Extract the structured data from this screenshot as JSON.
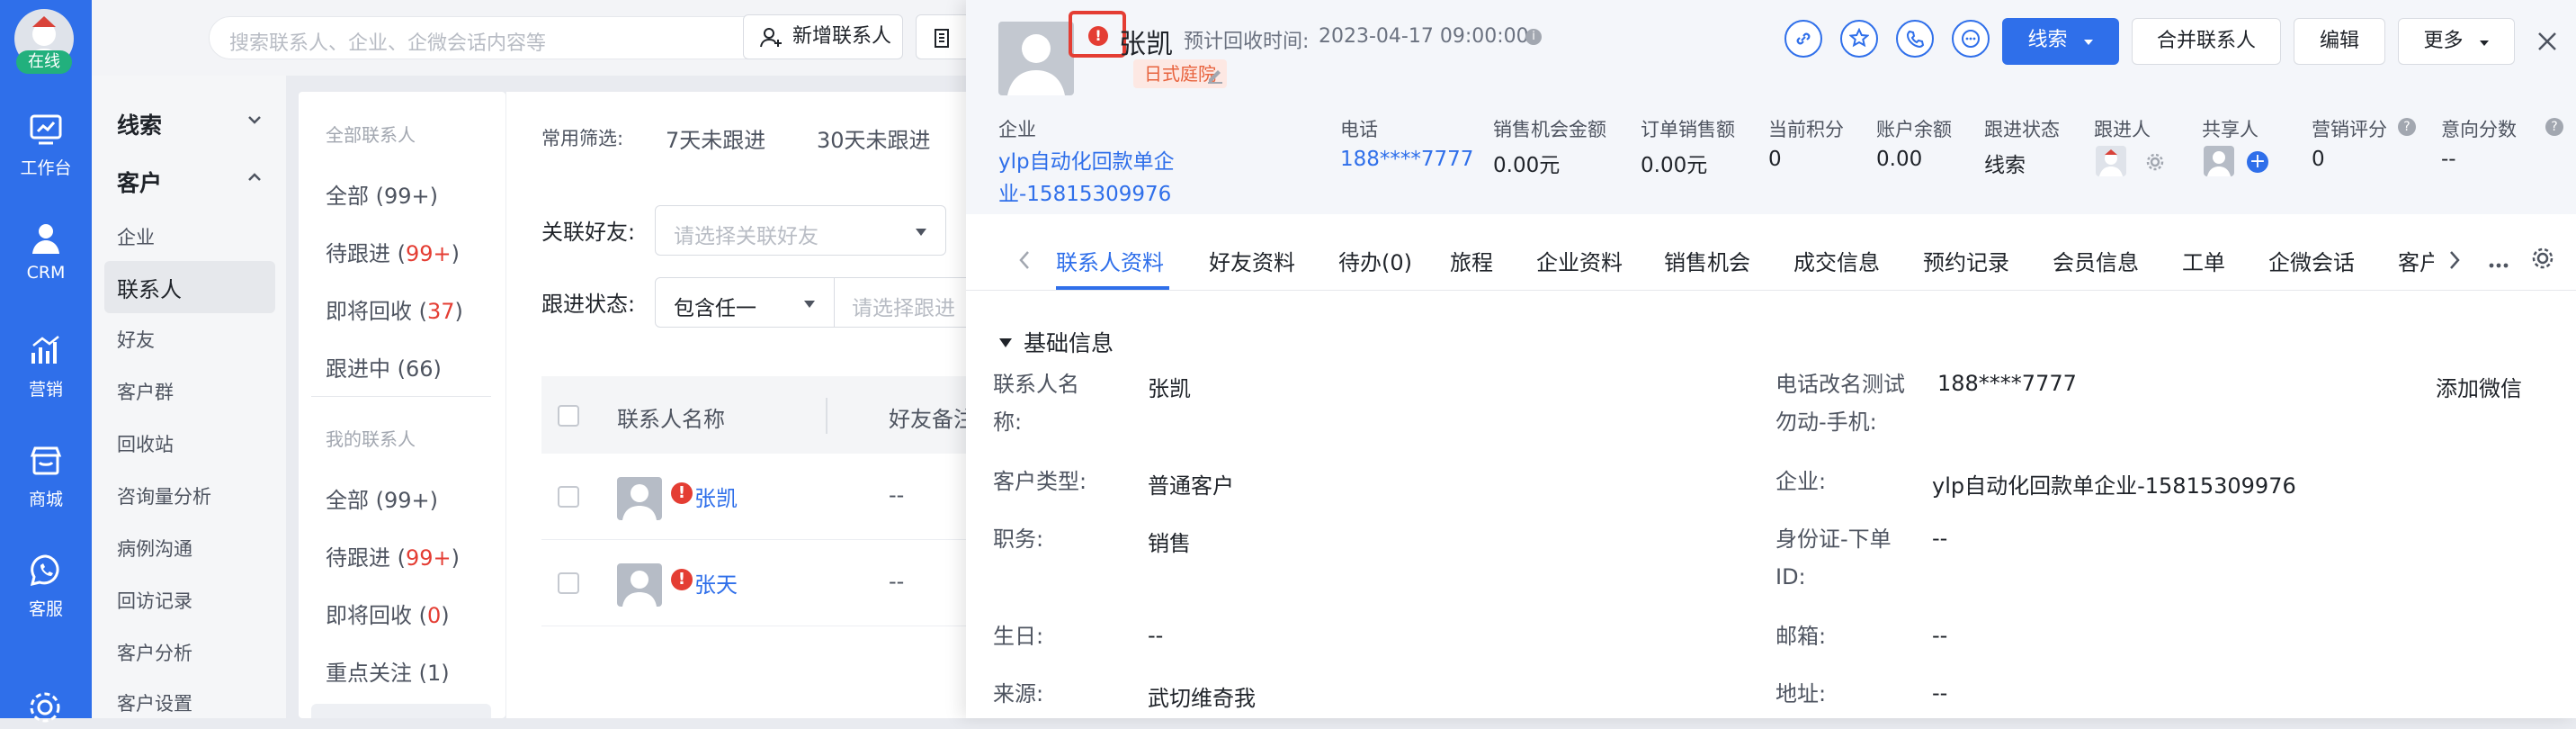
{
  "rail": {
    "status": "在线",
    "items": [
      {
        "label": "工作台",
        "icon": "dashboard-icon"
      },
      {
        "label": "CRM",
        "icon": "person-icon"
      },
      {
        "label": "营销",
        "icon": "bar-chart-icon"
      },
      {
        "label": "商城",
        "icon": "shop-icon"
      },
      {
        "label": "客服",
        "icon": "whatsapp-icon"
      }
    ]
  },
  "topbar": {
    "search_placeholder": "搜索联系人、企业、企微会话内容等",
    "add_contact": "新增联系人"
  },
  "nav": {
    "group1": "线索",
    "group2": "客户",
    "items": [
      "企业",
      "联系人",
      "好友",
      "客户群",
      "回收站",
      "咨询量分析",
      "病例沟通",
      "回访记录",
      "客户分析",
      "客户设置"
    ]
  },
  "sublist": {
    "section_all": "全部联系人",
    "all_label": "全部 (99+)",
    "pending_prefix": "待跟进 (",
    "pending_count": "99+",
    "suffix": ")",
    "recycle_prefix": "即将回收 (",
    "recycle_count": "37",
    "inprogress_label": "跟进中 (66)",
    "section_mine": "我的联系人",
    "mine_all": "全部 (99+)",
    "mine_pending_count": "99+",
    "mine_recycle_count": "0",
    "focus_label": "重点关注 (1)"
  },
  "listarea": {
    "filter_label": "常用筛选:",
    "filter_7": "7天未跟进",
    "filter_30": "30天未跟进",
    "friend_label": "关联好友:",
    "friend_placeholder": "请选择关联好友",
    "status_label": "跟进状态:",
    "status_value": "包含任一",
    "status_placeholder": "请选择跟进",
    "col_name": "联系人名称",
    "col_remark": "好友备注",
    "rows": [
      {
        "name": "张凯",
        "remark": "--"
      },
      {
        "name": "张天",
        "remark": "--"
      }
    ]
  },
  "panel": {
    "name": "张凯",
    "recycle_label": "预计回收时间:",
    "recycle_time": "2023-04-17 09:00:00",
    "tag": "日式庭院",
    "btn_clue": "线索",
    "btn_merge": "合并联系人",
    "btn_edit": "编辑",
    "btn_more": "更多",
    "summary": {
      "company_label": "企业",
      "company_value_1": "ylp自动化回款单企",
      "company_value_2": "业-15815309976",
      "phone_label": "电话",
      "phone_value": "188****7777",
      "opp_label": "销售机会金额",
      "opp_value": "0.00元",
      "order_label": "订单销售额",
      "order_value": "0.00元",
      "points_label": "当前积分",
      "points_value": "0",
      "balance_label": "账户余额",
      "balance_value": "0.00",
      "status_label": "跟进状态",
      "status_value": "线索",
      "follower_label": "跟进人",
      "share_label": "共享人",
      "score_label": "营销评分",
      "score_value": "0",
      "intent_label": "意向分数",
      "intent_value": "--"
    },
    "tabs": [
      "联系人资料",
      "好友资料",
      "待办(0)",
      "旅程",
      "企业资料",
      "销售机会",
      "成交信息",
      "预约记录",
      "会员信息",
      "工单",
      "企微会话",
      "客户"
    ],
    "section_title": "基础信息",
    "add_wechat": "添加微信",
    "fields": {
      "name_label_1": "联系人名",
      "name_label_2": "称:",
      "name_value": "张凯",
      "phone_label_1": "电话改名测试",
      "phone_label_2": "勿动-手机:",
      "phone_value": "188****7777",
      "type_label": "客户类型:",
      "type_value": "普通客户",
      "company_label": "企业:",
      "company_value": "ylp自动化回款单企业-15815309976",
      "job_label": "职务:",
      "job_value": "销售",
      "id_label_1": "身份证-下单",
      "id_label_2": "ID:",
      "id_value": "--",
      "birthday_label": "生日:",
      "birthday_value": "--",
      "email_label": "邮箱:",
      "email_value": "--",
      "source_label": "来源:",
      "source_value": "武切维奇我",
      "address_label": "地址:",
      "address_value": "--"
    }
  }
}
